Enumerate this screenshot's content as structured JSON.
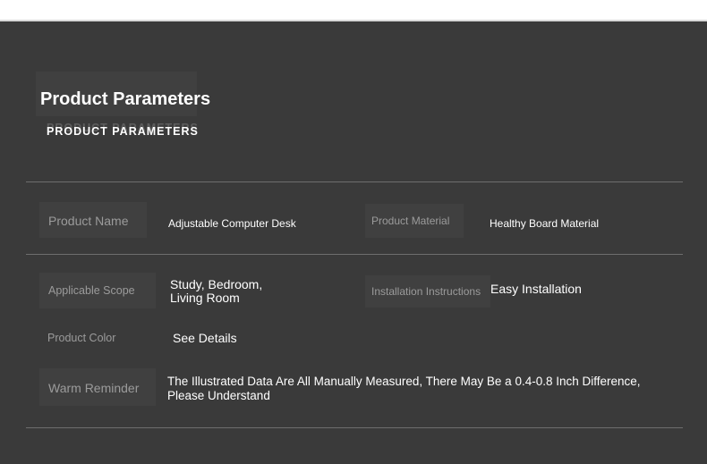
{
  "section": {
    "title": "Product Parameters",
    "subtitle": "PRODUCT PARAMETERS"
  },
  "params": {
    "product_name": {
      "label": "Product Name",
      "value": "Adjustable Computer Desk"
    },
    "product_material": {
      "label": "Product Material",
      "value": "Healthy Board Material"
    },
    "applicable_scope": {
      "label": "Applicable Scope",
      "value_line1": "Study, Bedroom,",
      "value_line2": "Living Room"
    },
    "installation_instructions": {
      "label": "Installation Instructions",
      "value": "Easy Installation"
    },
    "product_color": {
      "label": "Product Color",
      "value": "See Details"
    },
    "warm_reminder": {
      "label": "Warm Reminder",
      "value_line1": "The Illustrated Data Are All Manually Measured, There May Be a 0.4-0.8 Inch Difference,",
      "value_line2": "Please Understand"
    }
  },
  "colors": {
    "background": "#3a3a3a",
    "label": "#9b9b9b",
    "value": "#ffffff",
    "divider": "#6e6e6e"
  }
}
